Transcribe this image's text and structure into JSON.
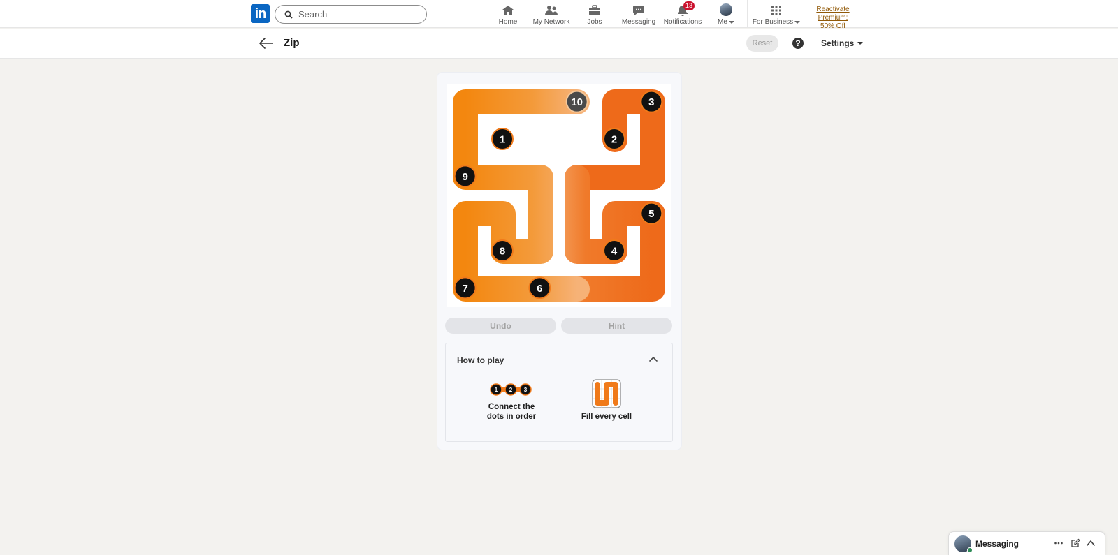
{
  "nav": {
    "search_placeholder": "Search",
    "items": [
      {
        "label": "Home",
        "icon": "home-icon"
      },
      {
        "label": "My Network",
        "icon": "network-icon"
      },
      {
        "label": "Jobs",
        "icon": "briefcase-icon"
      },
      {
        "label": "Messaging",
        "icon": "chat-icon"
      },
      {
        "label": "Notifications",
        "icon": "bell-icon",
        "badge": "13"
      },
      {
        "label": "Me",
        "icon": "avatar"
      },
      {
        "label": "For Business",
        "icon": "grid-icon"
      }
    ],
    "premium_line1": "Reactivate Premium:",
    "premium_line2": "50% Off",
    "brand_color": "#0a66c2"
  },
  "header": {
    "title": "Zip",
    "reset_label": "Reset",
    "help_glyph": "?",
    "settings_label": "Settings"
  },
  "game": {
    "grid_size": 6,
    "path_color": "#f07a1a",
    "dots": [
      {
        "label": "1",
        "row": 1,
        "col": 1
      },
      {
        "label": "2",
        "row": 1,
        "col": 4
      },
      {
        "label": "3",
        "row": 0,
        "col": 5
      },
      {
        "label": "4",
        "row": 4,
        "col": 4
      },
      {
        "label": "5",
        "row": 3,
        "col": 5
      },
      {
        "label": "6",
        "row": 5,
        "col": 2
      },
      {
        "label": "7",
        "row": 5,
        "col": 0
      },
      {
        "label": "8",
        "row": 4,
        "col": 1
      },
      {
        "label": "9",
        "row": 2,
        "col": 0
      },
      {
        "label": "10",
        "row": 0,
        "col": 3
      }
    ],
    "undo_label": "Undo",
    "hint_label": "Hint"
  },
  "how_to_play": {
    "title": "How to play",
    "rule1_dots": [
      "1",
      "2",
      "3"
    ],
    "rule1_line1": "Connect the",
    "rule1_line2": "dots in order",
    "rule2_text": "Fill every cell"
  },
  "messaging": {
    "label": "Messaging"
  }
}
